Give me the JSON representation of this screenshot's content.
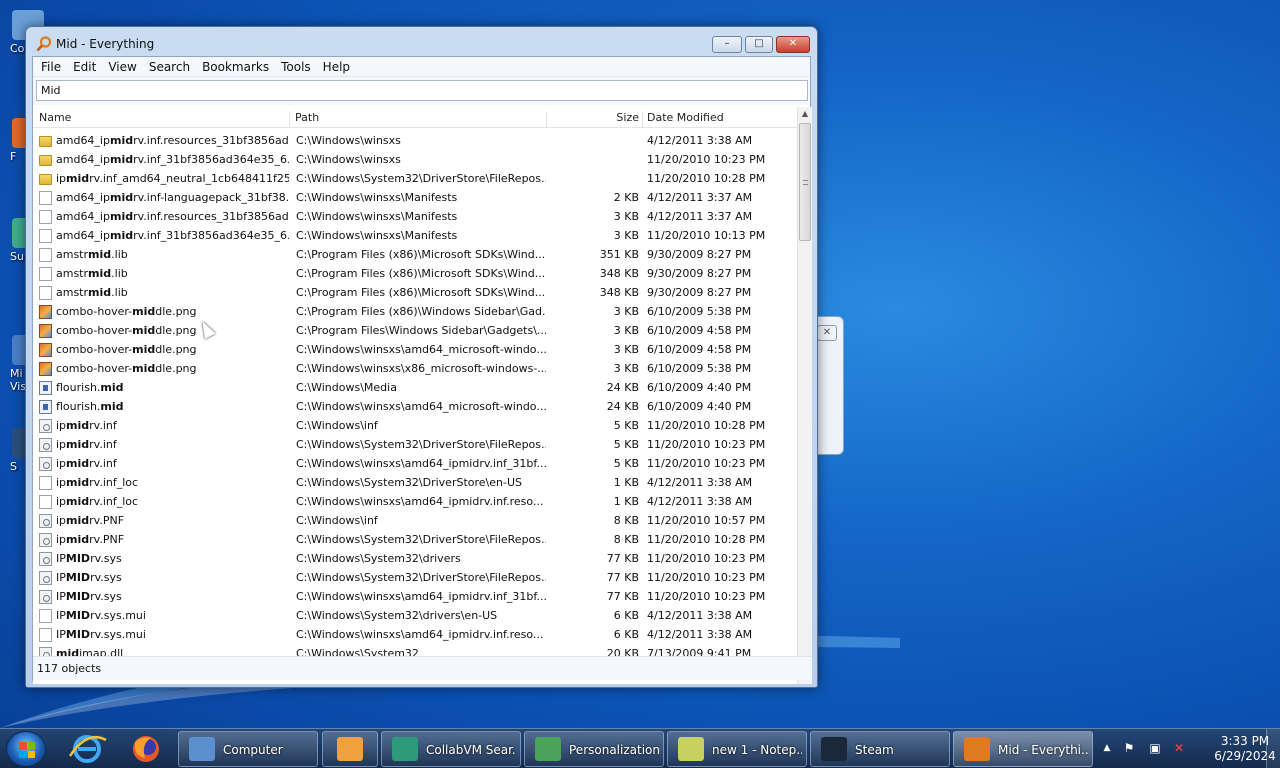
{
  "desktop": {
    "icons": [
      {
        "label": "Co",
        "color": "#6aa0d8"
      },
      {
        "label": "F",
        "color": "#e06a2a"
      },
      {
        "label": "Sup",
        "color": "#3fae8a"
      },
      {
        "label": "Mi Visu",
        "color": "#4a7fc8"
      },
      {
        "label": "S",
        "color": "#2c4f7a"
      }
    ]
  },
  "window": {
    "title": "Mid - Everything",
    "controls": {
      "minimize": "–",
      "maximize": "□",
      "close": "✕"
    },
    "menu": [
      "File",
      "Edit",
      "View",
      "Search",
      "Bookmarks",
      "Tools",
      "Help"
    ],
    "search": {
      "value": "Mid"
    },
    "columns": {
      "name": "Name",
      "path": "Path",
      "size": "Size",
      "date": "Date Modified"
    },
    "rows": [
      {
        "icon": "folder",
        "pre": "amd64_ip",
        "bold": "mid",
        "post": "rv.inf.resources_31bf3856ad3...",
        "path": "C:\\Windows\\winsxs",
        "size": "",
        "date": "4/12/2011 3:38 AM"
      },
      {
        "icon": "folder",
        "pre": "amd64_ip",
        "bold": "mid",
        "post": "rv.inf_31bf3856ad364e35_6.1....",
        "path": "C:\\Windows\\winsxs",
        "size": "",
        "date": "11/20/2010 10:23 PM"
      },
      {
        "icon": "folder",
        "pre": "ip",
        "bold": "mid",
        "post": "rv.inf_amd64_neutral_1cb648411f252...",
        "path": "C:\\Windows\\System32\\DriverStore\\FileRepos...",
        "size": "",
        "date": "11/20/2010 10:28 PM"
      },
      {
        "icon": "file",
        "pre": "amd64_ip",
        "bold": "mid",
        "post": "rv.inf-languagepack_31bf38...",
        "path": "C:\\Windows\\winsxs\\Manifests",
        "size": "2 KB",
        "date": "4/12/2011 3:37 AM"
      },
      {
        "icon": "file",
        "pre": "amd64_ip",
        "bold": "mid",
        "post": "rv.inf.resources_31bf3856ad3...",
        "path": "C:\\Windows\\winsxs\\Manifests",
        "size": "3 KB",
        "date": "4/12/2011 3:37 AM"
      },
      {
        "icon": "file",
        "pre": "amd64_ip",
        "bold": "mid",
        "post": "rv.inf_31bf3856ad364e35_6.1....",
        "path": "C:\\Windows\\winsxs\\Manifests",
        "size": "3 KB",
        "date": "11/20/2010 10:13 PM"
      },
      {
        "icon": "file",
        "pre": "amstr",
        "bold": "mid",
        "post": ".lib",
        "path": "C:\\Program Files (x86)\\Microsoft SDKs\\Wind...",
        "size": "351 KB",
        "date": "9/30/2009 8:27 PM"
      },
      {
        "icon": "file",
        "pre": "amstr",
        "bold": "mid",
        "post": ".lib",
        "path": "C:\\Program Files (x86)\\Microsoft SDKs\\Wind...",
        "size": "348 KB",
        "date": "9/30/2009 8:27 PM"
      },
      {
        "icon": "file",
        "pre": "amstr",
        "bold": "mid",
        "post": ".lib",
        "path": "C:\\Program Files (x86)\\Microsoft SDKs\\Wind...",
        "size": "348 KB",
        "date": "9/30/2009 8:27 PM"
      },
      {
        "icon": "png",
        "pre": "combo-hover-",
        "bold": "mid",
        "post": "dle.png",
        "path": "C:\\Program Files (x86)\\Windows Sidebar\\Gad...",
        "size": "3 KB",
        "date": "6/10/2009 5:38 PM"
      },
      {
        "icon": "png",
        "pre": "combo-hover-",
        "bold": "mid",
        "post": "dle.png",
        "path": "C:\\Program Files\\Windows Sidebar\\Gadgets\\...",
        "size": "3 KB",
        "date": "6/10/2009 4:58 PM"
      },
      {
        "icon": "png",
        "pre": "combo-hover-",
        "bold": "mid",
        "post": "dle.png",
        "path": "C:\\Windows\\winsxs\\amd64_microsoft-windo...",
        "size": "3 KB",
        "date": "6/10/2009 4:58 PM"
      },
      {
        "icon": "png",
        "pre": "combo-hover-",
        "bold": "mid",
        "post": "dle.png",
        "path": "C:\\Windows\\winsxs\\x86_microsoft-windows-...",
        "size": "3 KB",
        "date": "6/10/2009 5:38 PM"
      },
      {
        "icon": "media",
        "pre": "flourish.",
        "bold": "mid",
        "post": "",
        "path": "C:\\Windows\\Media",
        "size": "24 KB",
        "date": "6/10/2009 4:40 PM"
      },
      {
        "icon": "media",
        "pre": "flourish.",
        "bold": "mid",
        "post": "",
        "path": "C:\\Windows\\winsxs\\amd64_microsoft-windo...",
        "size": "24 KB",
        "date": "6/10/2009 4:40 PM"
      },
      {
        "icon": "gear",
        "pre": "ip",
        "bold": "mid",
        "post": "rv.inf",
        "path": "C:\\Windows\\inf",
        "size": "5 KB",
        "date": "11/20/2010 10:28 PM"
      },
      {
        "icon": "gear",
        "pre": "ip",
        "bold": "mid",
        "post": "rv.inf",
        "path": "C:\\Windows\\System32\\DriverStore\\FileRepos...",
        "size": "5 KB",
        "date": "11/20/2010 10:23 PM"
      },
      {
        "icon": "gear",
        "pre": "ip",
        "bold": "mid",
        "post": "rv.inf",
        "path": "C:\\Windows\\winsxs\\amd64_ipmidrv.inf_31bf...",
        "size": "5 KB",
        "date": "11/20/2010 10:23 PM"
      },
      {
        "icon": "file",
        "pre": "ip",
        "bold": "mid",
        "post": "rv.inf_loc",
        "path": "C:\\Windows\\System32\\DriverStore\\en-US",
        "size": "1 KB",
        "date": "4/12/2011 3:38 AM"
      },
      {
        "icon": "file",
        "pre": "ip",
        "bold": "mid",
        "post": "rv.inf_loc",
        "path": "C:\\Windows\\winsxs\\amd64_ipmidrv.inf.reso...",
        "size": "1 KB",
        "date": "4/12/2011 3:38 AM"
      },
      {
        "icon": "gear",
        "pre": "ip",
        "bold": "mid",
        "post": "rv.PNF",
        "path": "C:\\Windows\\inf",
        "size": "8 KB",
        "date": "11/20/2010 10:57 PM"
      },
      {
        "icon": "gear",
        "pre": "ip",
        "bold": "mid",
        "post": "rv.PNF",
        "path": "C:\\Windows\\System32\\DriverStore\\FileRepos...",
        "size": "8 KB",
        "date": "11/20/2010 10:28 PM"
      },
      {
        "icon": "gear",
        "pre": "IP",
        "bold": "MID",
        "post": "rv.sys",
        "path": "C:\\Windows\\System32\\drivers",
        "size": "77 KB",
        "date": "11/20/2010 10:23 PM"
      },
      {
        "icon": "gear",
        "pre": "IP",
        "bold": "MID",
        "post": "rv.sys",
        "path": "C:\\Windows\\System32\\DriverStore\\FileRepos...",
        "size": "77 KB",
        "date": "11/20/2010 10:23 PM"
      },
      {
        "icon": "gear",
        "pre": "IP",
        "bold": "MID",
        "post": "rv.sys",
        "path": "C:\\Windows\\winsxs\\amd64_ipmidrv.inf_31bf...",
        "size": "77 KB",
        "date": "11/20/2010 10:23 PM"
      },
      {
        "icon": "file",
        "pre": "IP",
        "bold": "MID",
        "post": "rv.sys.mui",
        "path": "C:\\Windows\\System32\\drivers\\en-US",
        "size": "6 KB",
        "date": "4/12/2011 3:38 AM"
      },
      {
        "icon": "file",
        "pre": "IP",
        "bold": "MID",
        "post": "rv.sys.mui",
        "path": "C:\\Windows\\winsxs\\amd64_ipmidrv.inf.reso...",
        "size": "6 KB",
        "date": "4/12/2011 3:38 AM"
      },
      {
        "icon": "gear",
        "pre": "",
        "bold": "mid",
        "post": "imap.dll",
        "path": "C:\\Windows\\System32",
        "size": "20 KB",
        "date": "7/13/2009 9:41 PM"
      }
    ],
    "status": "117 objects"
  },
  "taskbar": {
    "items": [
      {
        "label": "Computer",
        "color": "#5b8fd0",
        "active": false
      },
      {
        "label": "",
        "color": "#f0a040",
        "active": false
      },
      {
        "label": "CollabVM Sear...",
        "color": "#2f9a7a",
        "active": false
      },
      {
        "label": "Personalization",
        "color": "#4aa35a",
        "active": false
      },
      {
        "label": "new 1 - Notep...",
        "color": "#c8d060",
        "active": false
      },
      {
        "label": "Steam",
        "color": "#1b2838",
        "active": false
      },
      {
        "label": "Mid - Everythi...",
        "color": "#e07a20",
        "active": true
      }
    ],
    "clock": {
      "time": "3:33 PM",
      "date": "6/29/2024"
    },
    "tray": {
      "chevron": "▲",
      "flag": "⚑",
      "network": "▣",
      "volume": "✕"
    }
  },
  "colors": {
    "accent": "#1f5fa8",
    "folder": "#f0c850",
    "highlight_text": "#000000"
  }
}
